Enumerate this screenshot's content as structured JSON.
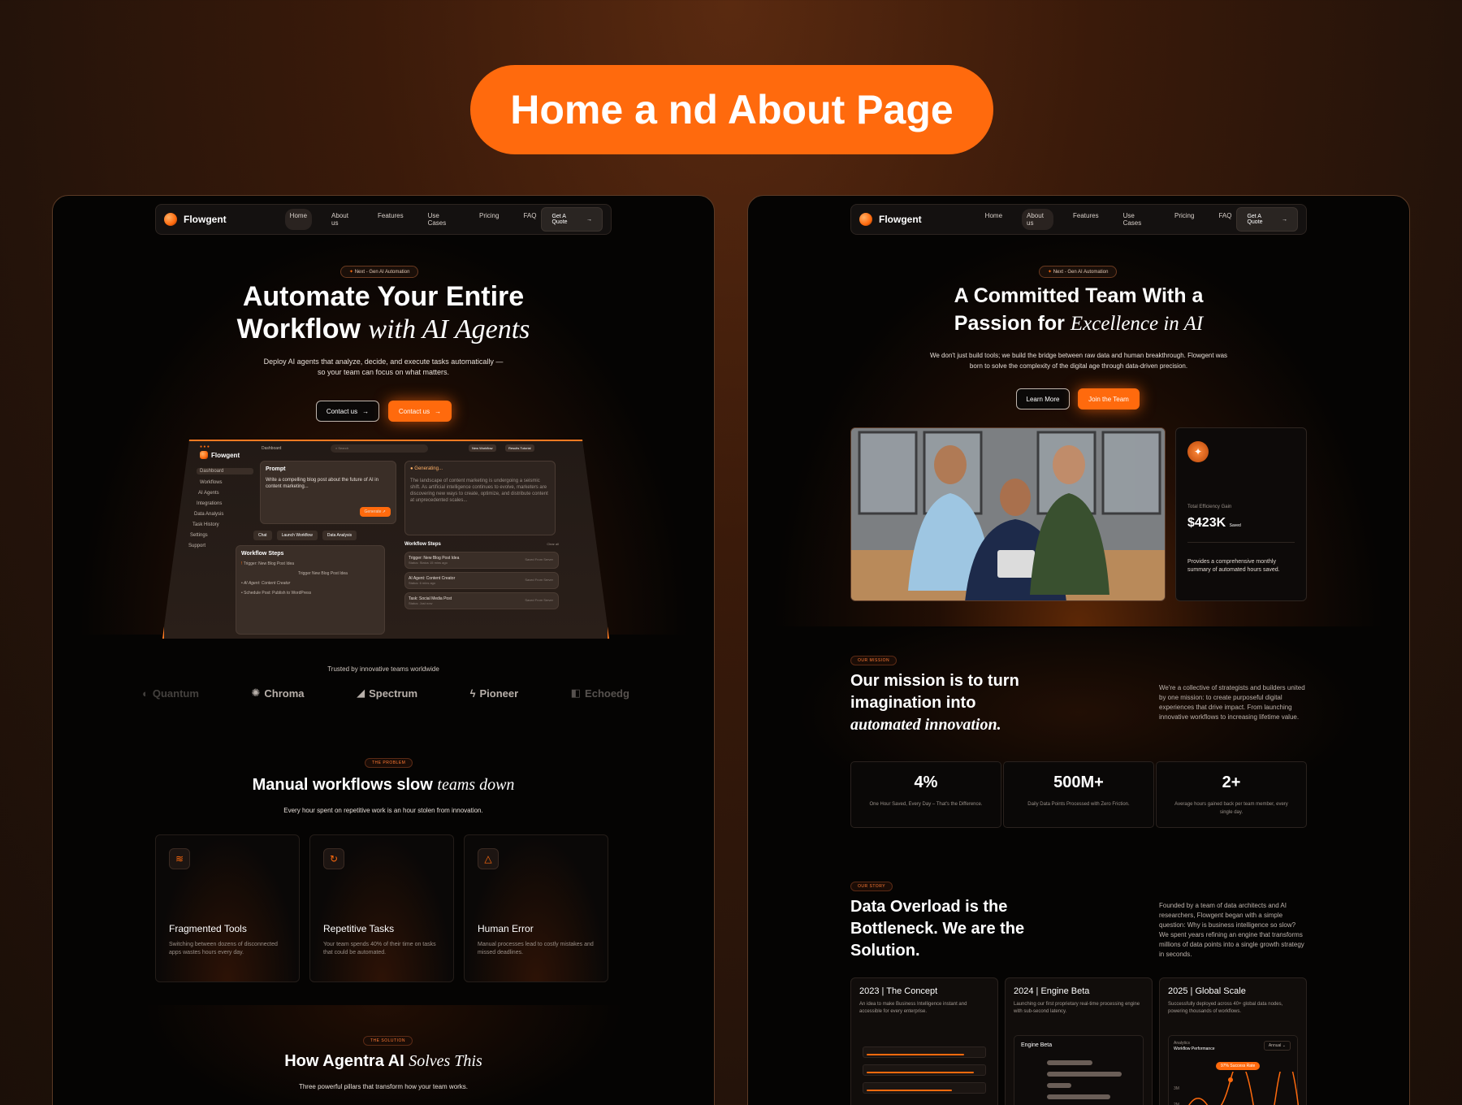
{
  "title": "Home a nd About Page",
  "colors": {
    "accent": "#ff6a0d",
    "panel_bg": "#050403"
  },
  "nav": {
    "brand": "Flowgent",
    "links": [
      "Home",
      "About us",
      "Features",
      "Use Cases",
      "Pricing",
      "FAQ"
    ],
    "cta": "Get A Quote"
  },
  "home": {
    "pill": "Next - Gen AI Automation",
    "headline_1": "Automate Your Entire",
    "headline_2a": "Workflow",
    "headline_2b": "with AI Agents",
    "subtitle_1": "Deploy AI agents that analyze, decide, and execute tasks automatically —",
    "subtitle_2": "so your team can focus on what matters.",
    "btn_1": "Contact us",
    "btn_2": "Contact us",
    "dashboard": {
      "brand": "Flowgent",
      "crumb": "Dashboard",
      "search": "Search",
      "new_workflow": "New Workflow",
      "results": "Results Tutorial",
      "sidebar": [
        "Dashboard",
        "Workflows",
        "AI Agents",
        "Integrations",
        "Data Analysis",
        "Task History",
        "Settings",
        "Support"
      ],
      "prompt_title": "Prompt",
      "prompt_text": "Write a compelling blog post about the future of AI in content marketing...",
      "generate": "Generate",
      "generating": "Generating...",
      "generating_text": "The landscape of content marketing is undergoing a seismic shift. As artificial intelligence continues to evolve, marketers are discovering new ways to create, optimize, and distribute content at unprecedented scales...",
      "chips": [
        "Chat",
        "Launch Workflow",
        "Data Analysis"
      ],
      "wf_title_left": "Workflow Steps",
      "wf_left": [
        "Trigger: New Blog Post Idea",
        "Trigger New Blog Post Idea",
        "AI Agent: Content Creator",
        "Schedule Post: Publish to WordPress"
      ],
      "wf_title_right": "Workflow Steps",
      "clear_all": "Clear all",
      "wf_right": [
        {
          "name": "Trigger: New Blog Post Idea",
          "status": "Status: Status 15 mins ago",
          "meta": "Saved From Server"
        },
        {
          "name": "AI Agent: Content Creator",
          "status": "Status: 6 mins ago",
          "meta": "Saved From Server"
        },
        {
          "name": "Task: Social Media Post",
          "status": "Status: Just now",
          "meta": "Saved From Server"
        }
      ]
    },
    "trusted": "Trusted by innovative teams worldwide",
    "logos": [
      "Quantum",
      "Chroma",
      "Spectrum",
      "Pioneer",
      "Echoedg"
    ],
    "problem_tag": "THE PROBLEM",
    "problem_title_a": "Manual workflows slow",
    "problem_title_b": "teams down",
    "problem_sub": "Every hour spent on repetitive work is an hour stolen from innovation.",
    "features": [
      {
        "title": "Fragmented Tools",
        "desc": "Switching between dozens of disconnected apps wastes hours every day.",
        "icon": "layers-icon"
      },
      {
        "title": "Repetitive Tasks",
        "desc": "Your team spends 40% of their time on tasks that could be automated.",
        "icon": "refresh-icon"
      },
      {
        "title": "Human Error",
        "desc": "Manual processes lead to costly mistakes and missed deadlines.",
        "icon": "warning-icon"
      }
    ],
    "solution_tag": "THE SOLUTION",
    "solution_title_a": "How Agentra AI",
    "solution_title_b": "Solves This",
    "solution_sub": "Three powerful pillars that transform how your team works."
  },
  "about": {
    "pill": "Next - Gen AI Automation",
    "headline_1": "A Committed Team With a",
    "headline_2a": "Passion for",
    "headline_2b": "Excellence in AI",
    "subtitle_1": "We don't just build tools; we build the bridge between raw data and human breakthrough. Flowgent was",
    "subtitle_2": "born to solve the complexity of the digital age through data-driven precision.",
    "btn_1": "Learn More",
    "btn_2": "Join the Team",
    "stat_label": "Total Efficiency Gain",
    "stat_value": "$423K",
    "stat_unit": "Saved",
    "stat_desc": "Provides a comprehensive monthly summary of automated hours saved.",
    "mission_tag": "OUR MISSION",
    "mission_1": "Our mission is to turn",
    "mission_2": "imagination into",
    "mission_3": "automated innovation.",
    "mission_text": "We're a collective of strategists and builders united by one mission: to create purposeful digital experiences that drive impact. From launching innovative workflows to increasing lifetime value.",
    "stats": [
      {
        "value": "4%",
        "label": "One Hour Saved, Every Day – That's the Difference."
      },
      {
        "value": "500M+",
        "label": "Daily Data Points Processed with Zero Friction."
      },
      {
        "value": "2+",
        "label": "Average hours gained back per team member, every single day."
      }
    ],
    "story_tag": "OUR STORY",
    "story_1": "Data Overload is the",
    "story_2": "Bottleneck. We are the",
    "story_3": "Solution.",
    "story_text": "Founded by a team of data architects and AI researchers, Flowgent began with a simple question: Why is business intelligence so slow? We spent years refining an engine that transforms millions of data points into a single growth strategy in seconds.",
    "timeline": [
      {
        "title": "2023 | The Concept",
        "desc": "An idea to make Business Intelligence instant and accessible for every enterprise."
      },
      {
        "title": "2024 | Engine Beta",
        "desc": "Launching our first proprietary real-time processing engine with sub-second latency."
      },
      {
        "title": "2025 | Global Scale",
        "desc": "Successfully deployed across 40+ global data nodes, powering thousands of workflows."
      }
    ],
    "engine_beta": "Engine Beta",
    "analytics": "Analytics",
    "workflow_perf": "Workflow Performance",
    "annual": "Annual",
    "success_rate": "97% Success Rate",
    "y_labels": [
      "3M",
      "2M"
    ]
  }
}
